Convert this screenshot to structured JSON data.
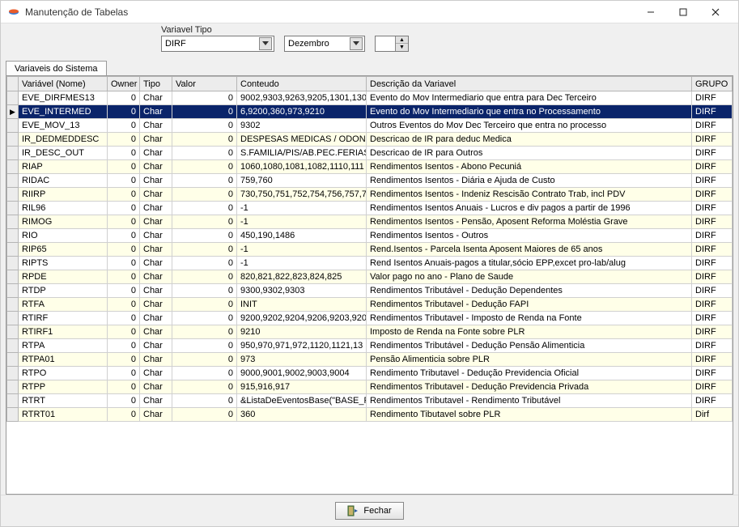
{
  "window": {
    "title": "Manutenção de Tabelas"
  },
  "controls": {
    "variavel_tipo_label": "Variavel Tipo",
    "variavel_tipo_value": "DIRF",
    "mes_value": "Dezembro",
    "spinner_value": ""
  },
  "tab": {
    "label": "Variaveis do Sistema"
  },
  "grid": {
    "headers": {
      "nome": "Variável (Nome)",
      "owner": "Owner",
      "tipo": "Tipo",
      "valor": "Valor",
      "conteudo": "Conteudo",
      "desc": "Descrição da Variavel",
      "grupo": "GRUPO"
    },
    "rows": [
      {
        "nome": "EVE_DIRFMES13",
        "owner": "0",
        "tipo": "Char",
        "valor": "0",
        "conteudo": "9002,9303,9263,9205,1301,130",
        "desc": "Evento do Mov Intermediario que entra para Dec Terceiro",
        "grupo": "DIRF",
        "selected": false
      },
      {
        "nome": "EVE_INTERMED",
        "owner": "0",
        "tipo": "Char",
        "valor": "0",
        "conteudo": "6,9200,360,973,9210",
        "desc": "Evento do Mov Intermediario que entra no Processamento",
        "grupo": "DIRF",
        "selected": true
      },
      {
        "nome": "EVE_MOV_13",
        "owner": "0",
        "tipo": "Char",
        "valor": "0",
        "conteudo": "9302",
        "desc": "Outros Eventos do Mov Dec Terceiro que entra no processo",
        "grupo": "DIRF",
        "selected": false
      },
      {
        "nome": "IR_DEDMEDDESC",
        "owner": "0",
        "tipo": "Char",
        "valor": "0",
        "conteudo": "DESPESAS MEDICAS / ODON",
        "desc": "Descricao de IR para deduc Medica",
        "grupo": "DIRF",
        "selected": false
      },
      {
        "nome": "IR_DESC_OUT",
        "owner": "0",
        "tipo": "Char",
        "valor": "0",
        "conteudo": "S.FAMILIA/PIS/AB.PEC.FERIAS",
        "desc": "Descricao de IR para Outros",
        "grupo": "DIRF",
        "selected": false
      },
      {
        "nome": "RIAP",
        "owner": "0",
        "tipo": "Char",
        "valor": "0",
        "conteudo": "1060,1080,1081,1082,1110,111",
        "desc": "Rendimentos Isentos - Abono Pecuniá",
        "grupo": "DIRF",
        "selected": false
      },
      {
        "nome": "RIDAC",
        "owner": "0",
        "tipo": "Char",
        "valor": "0",
        "conteudo": "759,760",
        "desc": "Rendimentos Isentos - Diária e Ajuda de Custo",
        "grupo": "DIRF",
        "selected": false
      },
      {
        "nome": "RIIRP",
        "owner": "0",
        "tipo": "Char",
        "valor": "0",
        "conteudo": "730,750,751,752,754,756,757,7",
        "desc": "Rendimentos Isentos - Indeniz Rescisão Contrato Trab, incl PDV",
        "grupo": "DIRF",
        "selected": false
      },
      {
        "nome": "RIL96",
        "owner": "0",
        "tipo": "Char",
        "valor": "0",
        "conteudo": "-1",
        "desc": "Rendimentos Isentos Anuais - Lucros e div pagos a partir de 1996",
        "grupo": "DIRF",
        "selected": false
      },
      {
        "nome": "RIMOG",
        "owner": "0",
        "tipo": "Char",
        "valor": "0",
        "conteudo": "-1",
        "desc": "Rendimentos Isentos - Pensão, Aposent Reforma Moléstia Grave",
        "grupo": "DIRF",
        "selected": false
      },
      {
        "nome": "RIO",
        "owner": "0",
        "tipo": "Char",
        "valor": "0",
        "conteudo": "450,190,1486",
        "desc": "Rendimentos Isentos - Outros",
        "grupo": "DIRF",
        "selected": false
      },
      {
        "nome": "RIP65",
        "owner": "0",
        "tipo": "Char",
        "valor": "0",
        "conteudo": "-1",
        "desc": "Rend.Isentos - Parcela Isenta Aposent Maiores de 65 anos",
        "grupo": "DIRF",
        "selected": false
      },
      {
        "nome": "RIPTS",
        "owner": "0",
        "tipo": "Char",
        "valor": "0",
        "conteudo": "-1",
        "desc": "Rend Isentos Anuais-pagos a titular,sócio EPP,excet pro-lab/alug",
        "grupo": "DIRF",
        "selected": false
      },
      {
        "nome": "RPDE",
        "owner": "0",
        "tipo": "Char",
        "valor": "0",
        "conteudo": "820,821,822,823,824,825",
        "desc": "Valor pago no ano - Plano de Saude",
        "grupo": "DIRF",
        "selected": false
      },
      {
        "nome": "RTDP",
        "owner": "0",
        "tipo": "Char",
        "valor": "0",
        "conteudo": "9300,9302,9303",
        "desc": "Rendimentos Tributável - Dedução Dependentes",
        "grupo": "DIRF",
        "selected": false
      },
      {
        "nome": "RTFA",
        "owner": "0",
        "tipo": "Char",
        "valor": "0",
        "conteudo": "INIT",
        "desc": "Rendimentos Tributavel - Dedução FAPI",
        "grupo": "DIRF",
        "selected": false
      },
      {
        "nome": "RTIRF",
        "owner": "0",
        "tipo": "Char",
        "valor": "0",
        "conteudo": "9200,9202,9204,9206,9203,920",
        "desc": "Rendimentos Tributavel - Imposto de Renda na Fonte",
        "grupo": "DIRF",
        "selected": false
      },
      {
        "nome": "RTIRF1",
        "owner": "0",
        "tipo": "Char",
        "valor": "0",
        "conteudo": "9210",
        "desc": "Imposto de Renda na Fonte sobre PLR",
        "grupo": "DIRF",
        "selected": false
      },
      {
        "nome": "RTPA",
        "owner": "0",
        "tipo": "Char",
        "valor": "0",
        "conteudo": "950,970,971,972,1120,1121,13",
        "desc": "Rendimentos Tributável - Dedução Pensão Alimenticia",
        "grupo": "DIRF",
        "selected": false
      },
      {
        "nome": "RTPA01",
        "owner": "0",
        "tipo": "Char",
        "valor": "0",
        "conteudo": "973",
        "desc": "Pensão Alimenticia sobre PLR",
        "grupo": "DIRF",
        "selected": false
      },
      {
        "nome": "RTPO",
        "owner": "0",
        "tipo": "Char",
        "valor": "0",
        "conteudo": "9000,9001,9002,9003,9004",
        "desc": "Rendimento Tributavel - Dedução Previdencia Oficial",
        "grupo": "DIRF",
        "selected": false
      },
      {
        "nome": "RTPP",
        "owner": "0",
        "tipo": "Char",
        "valor": "0",
        "conteudo": "915,916,917",
        "desc": "Rendimentos Tributavel - Dedução Previdencia Privada",
        "grupo": "DIRF",
        "selected": false
      },
      {
        "nome": "RTRT",
        "owner": "0",
        "tipo": "Char",
        "valor": "0",
        "conteudo": "&ListaDeEventosBase(\"BASE_P",
        "desc": "Rendimentos Tributavel - Rendimento Tributável",
        "grupo": "DIRF",
        "selected": false
      },
      {
        "nome": "RTRT01",
        "owner": "0",
        "tipo": "Char",
        "valor": "0",
        "conteudo": "360",
        "desc": "Rendimento Tibutavel sobre PLR",
        "grupo": "Dirf",
        "selected": false
      }
    ]
  },
  "footer": {
    "fechar_label": "Fechar"
  }
}
